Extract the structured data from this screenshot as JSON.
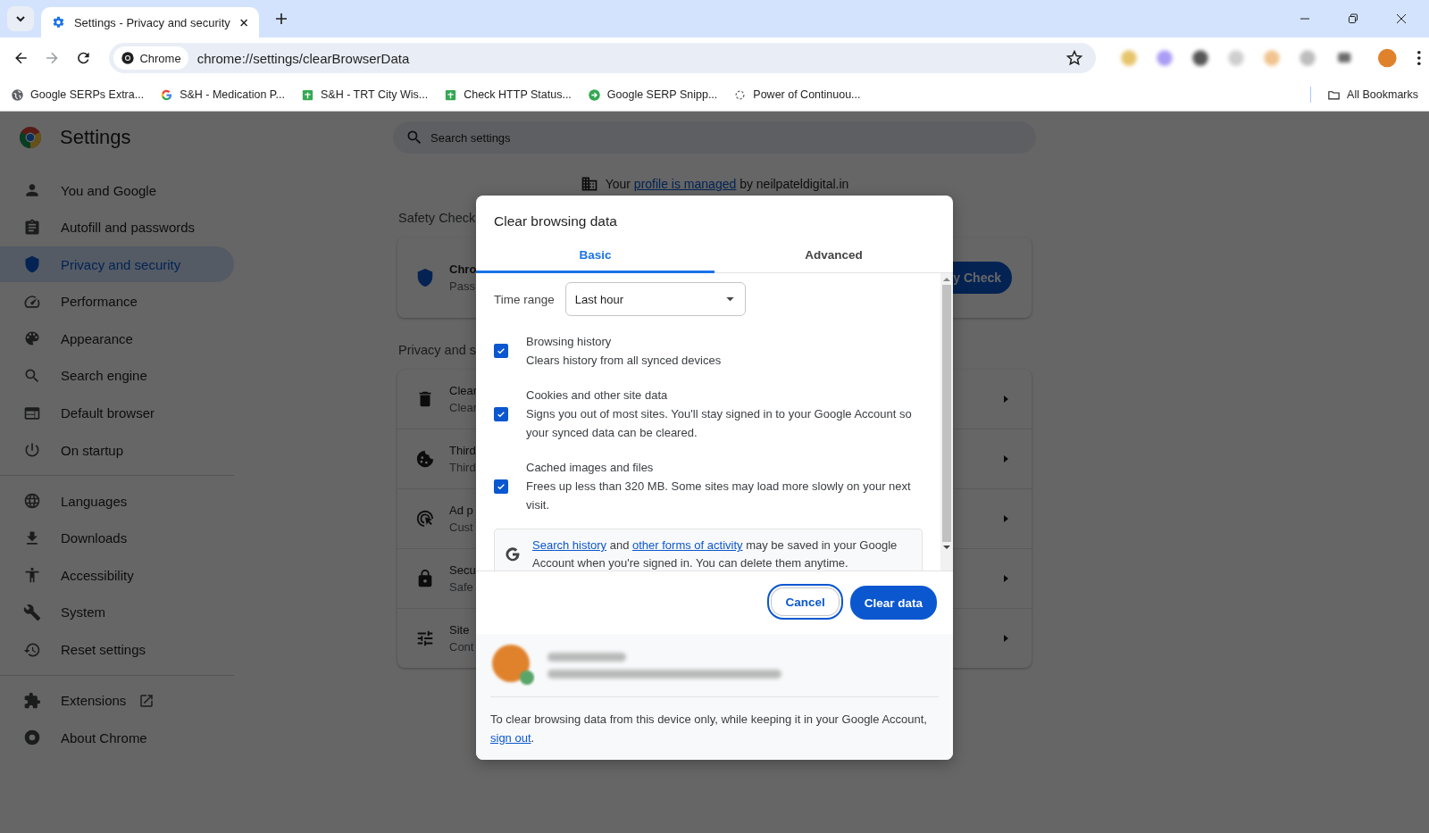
{
  "browser": {
    "tab_title": "Settings - Privacy and security",
    "chip": "Chrome",
    "url": "chrome://settings/clearBrowserData",
    "bookmarks": [
      {
        "label": "Google SERPs Extra..."
      },
      {
        "label": "S&H - Medication P..."
      },
      {
        "label": "S&H - TRT City Wis..."
      },
      {
        "label": "Check HTTP Status..."
      },
      {
        "label": "Google SERP Snipp..."
      },
      {
        "label": "Power of Continuou..."
      }
    ],
    "all_bookmarks": "All Bookmarks"
  },
  "settings": {
    "title": "Settings",
    "search_placeholder": "Search settings",
    "nav_groups": [
      [
        {
          "label": "You and Google",
          "selected": false
        },
        {
          "label": "Autofill and passwords",
          "selected": false
        },
        {
          "label": "Privacy and security",
          "selected": true
        },
        {
          "label": "Performance",
          "selected": false
        },
        {
          "label": "Appearance",
          "selected": false
        },
        {
          "label": "Search engine",
          "selected": false
        },
        {
          "label": "Default browser",
          "selected": false
        },
        {
          "label": "On startup",
          "selected": false
        }
      ],
      [
        {
          "label": "Languages",
          "selected": false
        },
        {
          "label": "Downloads",
          "selected": false
        },
        {
          "label": "Accessibility",
          "selected": false
        },
        {
          "label": "System",
          "selected": false
        },
        {
          "label": "Reset settings",
          "selected": false
        }
      ],
      [
        {
          "label": "Extensions",
          "selected": false
        },
        {
          "label": "About Chrome",
          "selected": false
        }
      ]
    ],
    "managed": {
      "before": "Your",
      "link": "profile is managed",
      "after": "by neilpateldigital.in"
    },
    "safety_check": {
      "heading": "Safety Check",
      "title": "Chro",
      "subtitle": "Pass",
      "button": "y Check"
    },
    "privacy": {
      "heading": "Privacy and s",
      "rows": [
        {
          "title": "Clear",
          "subtitle": "Clear"
        },
        {
          "title": "Third",
          "subtitle": "Third"
        },
        {
          "title": "Ad p",
          "subtitle": "Cust"
        },
        {
          "title": "Secu",
          "subtitle": "Safe"
        },
        {
          "title": "Site",
          "subtitle": "Cont"
        }
      ]
    }
  },
  "dialog": {
    "title": "Clear browsing data",
    "tabs": [
      {
        "label": "Basic",
        "selected": true
      },
      {
        "label": "Advanced",
        "selected": false
      }
    ],
    "time_range": {
      "label": "Time range",
      "value": "Last hour"
    },
    "options": [
      {
        "title": "Browsing history",
        "description": "Clears history from all synced devices",
        "checked": true
      },
      {
        "title": "Cookies and other site data",
        "description": "Signs you out of most sites. You'll stay signed in to your Google Account so your synced data can be cleared.",
        "checked": true
      },
      {
        "title": "Cached images and files",
        "description": "Frees up less than 320 MB. Some sites may load more slowly on your next visit.",
        "checked": true
      }
    ],
    "notice": {
      "link1": "Search history",
      "mid": "and",
      "link2": "other forms of activity",
      "rest": "may be saved in your Google Account when you're signed in. You can delete them anytime."
    },
    "cancel": "Cancel",
    "confirm": "Clear data",
    "footer": {
      "text": "To clear browsing data from this device only, while keeping it in your Google Account,",
      "link": "sign out",
      "end": "."
    }
  }
}
